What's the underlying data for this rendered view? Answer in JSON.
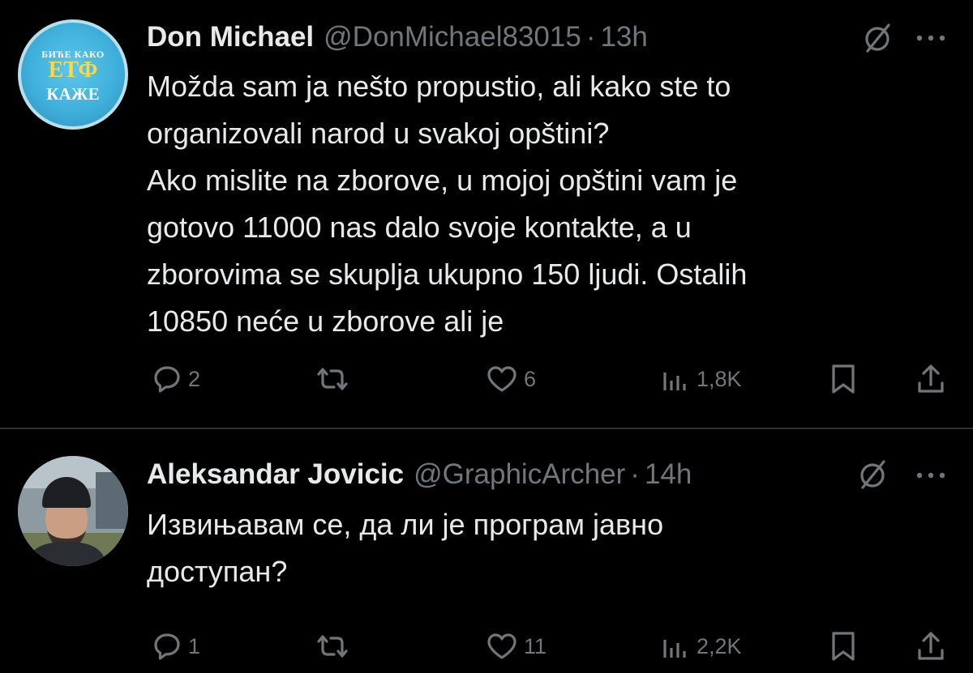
{
  "tweets": [
    {
      "avatar": {
        "lines": [
          "БИЋЕ КАКО",
          "ЕТФ",
          "КАЖЕ"
        ]
      },
      "name": "Don Michael",
      "handle": "@DonMichael83015",
      "dot": "·",
      "time": "13h",
      "lines": [
        "Možda sam ja nešto propustio, ali kako ste to",
        "organizovali narod u svakoj opštini?",
        "Ako mislite na zborove, u mojoj opštini vam je",
        "gotovo 11000 nas dalo svoje kontakte, a u",
        "zborovima se skuplja ukupno 150 ljudi. Ostalih",
        "10850 neće u zborove ali je"
      ],
      "actions": {
        "replies": "2",
        "retweets": "",
        "likes": "6",
        "views": "1,8K"
      }
    },
    {
      "name": "Aleksandar Jovicic",
      "handle": "@GraphicArcher",
      "dot": "·",
      "time": "14h",
      "lines": [
        "Извињавам се, да ли је програм јавно",
        "доступан?"
      ],
      "actions": {
        "replies": "1",
        "retweets": "",
        "likes": "11",
        "views": "2,2K"
      }
    }
  ],
  "icons": [
    "grok-icon",
    "more-icon",
    "reply-icon",
    "retweet-icon",
    "like-icon",
    "views-icon",
    "bookmark-icon",
    "share-icon"
  ],
  "colors": {
    "background": "#000000",
    "text": "#e7e9ea",
    "secondary": "#71767b",
    "divider": "#2f3336"
  }
}
